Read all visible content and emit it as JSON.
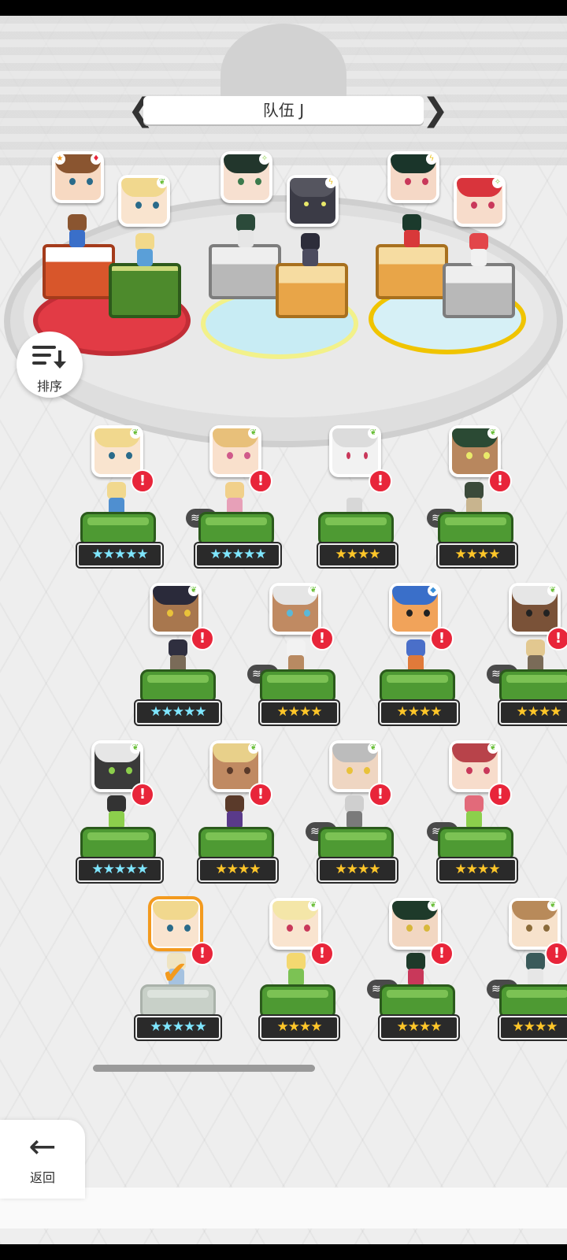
{
  "team": {
    "name": "队伍 J",
    "prev": "❮",
    "next": "❯"
  },
  "buttons": {
    "sort_label": "排序",
    "back_label": "返回",
    "back_icon": "←",
    "check": "✔",
    "alert": "!"
  },
  "stars": {
    "five": "★★★★★",
    "four": "★★★★"
  },
  "stacks": {
    "r1c2": "4",
    "r1c4": "1",
    "r2c2": "2",
    "r2c4": "1",
    "r3c3": "3",
    "r3c4": "3",
    "r4c3": "1",
    "r4c4": "2"
  },
  "colors": {
    "alert": "#e8253a",
    "selected": "#f39a1e",
    "grass": "#4e9a33",
    "star_gold": "#ffc629",
    "star_cyan": "#7fe6ff"
  },
  "icons": [
    "team-prev-arrow-icon",
    "team-next-arrow-icon",
    "sort-icon",
    "back-arrow-icon",
    "alert-icon",
    "element-icon",
    "check-icon",
    "stack-icon"
  ]
}
